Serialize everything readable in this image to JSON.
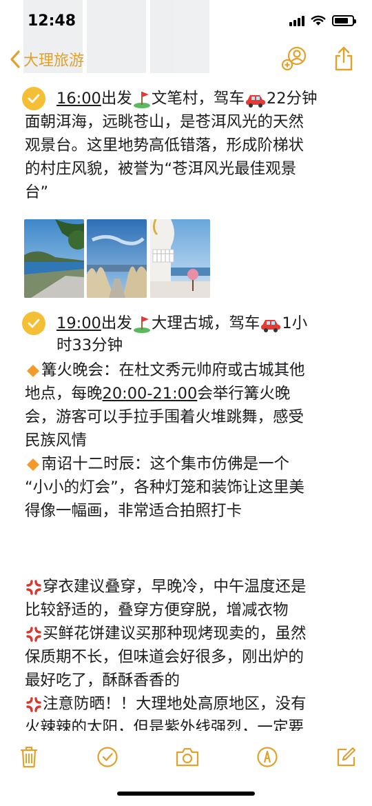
{
  "status_bar": {
    "time": "12:48",
    "battery_level": 0.8
  },
  "nav": {
    "back_label": "大理旅游",
    "icons": [
      "chevron-left-icon",
      "add-person-icon",
      "share-icon"
    ]
  },
  "colors": {
    "accent": "#e2a12b",
    "checkbox": "#f4bf35",
    "text": "#1c1c1e"
  },
  "note": {
    "item1": {
      "checked": true,
      "time": "16:00",
      "line1_a": "出发",
      "line1_b": "文笔村，驾车",
      "line1_c": "22分钟",
      "lines": [
        "面朝洱海，远眺苍山，是苍洱风光的天然",
        "观景台。这里地势高低错落，形成阶梯状",
        "的村庄风貌，被誉为“苍洱风光最佳观景",
        "台”"
      ],
      "photo_count": 3
    },
    "item2": {
      "checked": true,
      "time": "19:00",
      "line1_a": "出发",
      "line1_b": "大理古城，驾车",
      "line1_c": "1小",
      "line2": "时33分钟"
    },
    "bonfire": {
      "l1": "篝火晚会：在杜文秀元帅府或古城其他",
      "l2_a": "地点，每晚",
      "l2_u": "20:00-21:00",
      "l2_b": "会举行篝火晚",
      "l3": "会，游客可以手拉手围着火堆跳舞，感受",
      "l4": "民族风情"
    },
    "nanzhao": {
      "l1": "南诏十二时辰：这个集市仿佛是一个",
      "l2": "“小小的灯会”，各种灯笼和装饰让这里美",
      "l3": "得像一幅画，非常适合拍照打卡"
    },
    "tips": {
      "t1_l1": "穿衣建议叠穿，早晚冷，中午温度还是",
      "t1_l2": "比较舒适的，叠穿方便穿脱，增减衣物",
      "t2_l1": "买鲜花饼建议买那种现烤现卖的，虽然",
      "t2_l2": "保质期不长，但味道会好很多，刚出炉的",
      "t2_l3": "最好吃了，酥酥香香的",
      "t3_l1": "注意防晒！！大理地处高原地区，没有",
      "t3_l2": "火辣辣的太阳，但是紫外线强烈，一定要"
    }
  },
  "toolbar": {
    "icons": [
      "trash-icon",
      "checklist-icon",
      "camera-icon",
      "markup-icon",
      "compose-icon"
    ]
  }
}
